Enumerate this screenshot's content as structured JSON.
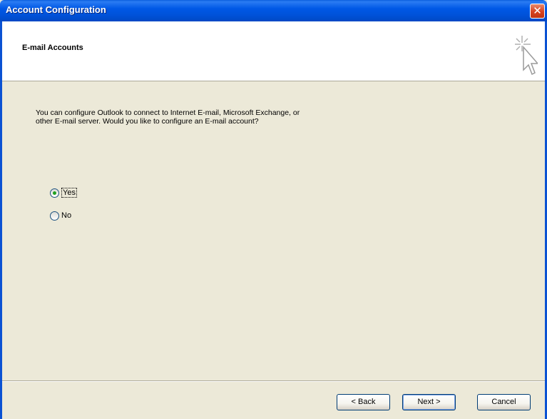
{
  "window": {
    "title": "Account Configuration",
    "close_glyph": "✕"
  },
  "header": {
    "title": "E-mail Accounts",
    "icon": "wizard-sparkle-cursor-icon"
  },
  "content": {
    "description_line1": "You can configure Outlook to connect to Internet E-mail, Microsoft Exchange, or",
    "description_line2": "other E-mail server. Would you like to configure an E-mail account?",
    "options": [
      {
        "label": "Yes",
        "selected": true
      },
      {
        "label": "No",
        "selected": false
      }
    ]
  },
  "buttons": {
    "back": "< Back",
    "next": "Next >",
    "cancel": "Cancel"
  },
  "colors": {
    "titlebar": "#0058e6",
    "close": "#d6411f",
    "dialog_bg": "#ece9d8"
  }
}
